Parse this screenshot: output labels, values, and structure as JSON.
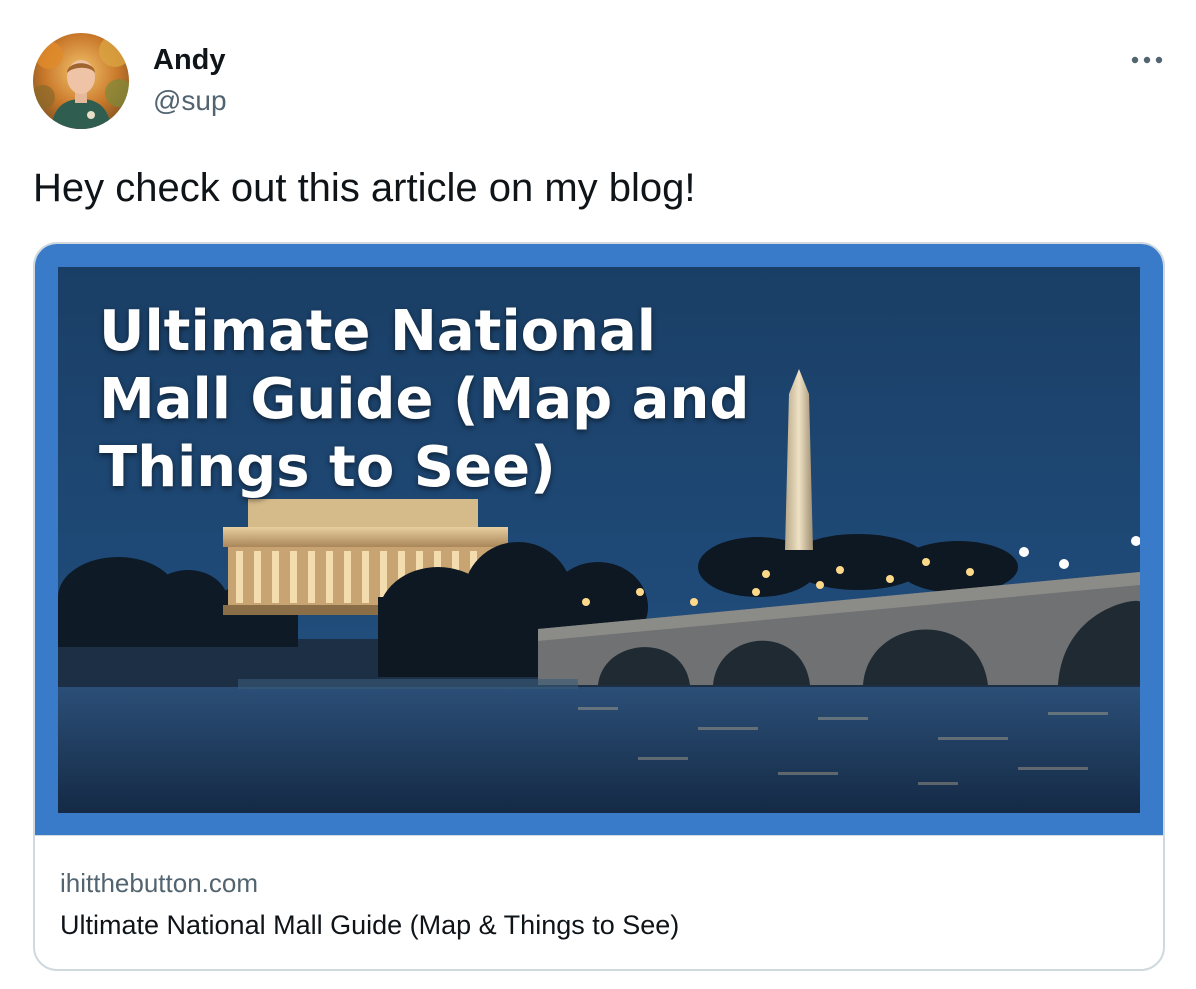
{
  "tweet": {
    "author": {
      "name": "Andy",
      "handle": "@sup"
    },
    "text": "Hey check out this article on my blog!",
    "menu_icon": "more-dots-icon"
  },
  "card": {
    "image_headline": "Ultimate National Mall Guide (Map and Things to See)",
    "domain": "ihitthebutton.com",
    "title": "Ultimate National Mall Guide (Map & Things to See)",
    "frame_color": "#3a7bc9"
  },
  "colors": {
    "text_primary": "#0f1419",
    "text_secondary": "#536471",
    "border": "#cfd9de"
  }
}
